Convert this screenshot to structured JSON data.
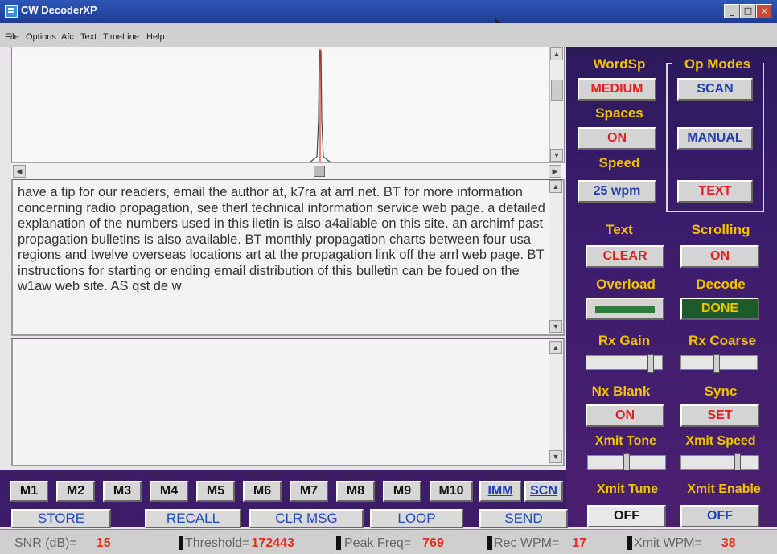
{
  "window": {
    "title": "CW DecoderXP",
    "btn_min": "_",
    "btn_max": "□",
    "btn_close": "×"
  },
  "menu": [
    "File",
    "Options",
    "Afc",
    "Text",
    "TimeLine",
    "Help"
  ],
  "decoded_text": "have a tip for our readers, email the author at, k7ra at arrl.net.  BT  for more information concerning radio propagation, see therl technical information service web page. a detailed explanation of the numbers used in this iletin is also a4ailable on this site. an archimf past propagation bulletins is also available.  BT  monthly propagation charts between four usa regions and twelve overseas locations art at the propagation link off the arrl web page. BT  instructions for starting or ending email distribution of this bulletin can be foued on the w1aw web site.  AS  qst de w",
  "right": {
    "wordsp_label": "WordSp",
    "wordsp_value": "MEDIUM",
    "spaces_label": "Spaces",
    "spaces_value": "ON",
    "speed_label": "Speed",
    "speed_value": "25 wpm",
    "opmodes_label": "Op Modes",
    "scan": "SCAN",
    "manual": "MANUAL",
    "text_mode": "TEXT",
    "text_label": "Text",
    "text_clear": "CLEAR",
    "scrolling_label": "Scrolling",
    "scrolling_value": "ON",
    "overload_label": "Overload",
    "decode_label": "Decode",
    "decode_value": "DONE",
    "rxgain_label": "Rx Gain",
    "rxcoarse_label": "Rx Coarse",
    "nxblank_label": "Nx Blank",
    "nxblank_value": "ON",
    "sync_label": "Sync",
    "sync_value": "SET",
    "xmittone_label": "Xmit Tone",
    "xmitspeed_label": "Xmit Speed",
    "xmittune_label": "Xmit Tune",
    "xmittune_value": "OFF",
    "xmitenable_label": "Xmit Enable",
    "xmitenable_value": "OFF"
  },
  "colors": {
    "overload_bar": "#2e7a3a",
    "decode_done": "#f2c300"
  },
  "memory_buttons": [
    "M1",
    "M2",
    "M3",
    "M4",
    "M5",
    "M6",
    "M7",
    "M8",
    "M9",
    "M10",
    "IMM",
    "SCN"
  ],
  "actions": {
    "store": "STORE",
    "recall": "RECALL",
    "clr_msg": "CLR MSG",
    "loop": "LOOP",
    "send": "SEND"
  },
  "status": {
    "snr_label": "SNR (dB)=",
    "snr_value": "15",
    "threshold_label": "Threshold=",
    "threshold_value": "172443",
    "peak_label": "Peak Freq=",
    "peak_value": "769",
    "recwpm_label": "Rec WPM=",
    "recwpm_value": "17",
    "xmitwpm_label": "Xmit WPM=",
    "xmitwpm_value": "38"
  }
}
